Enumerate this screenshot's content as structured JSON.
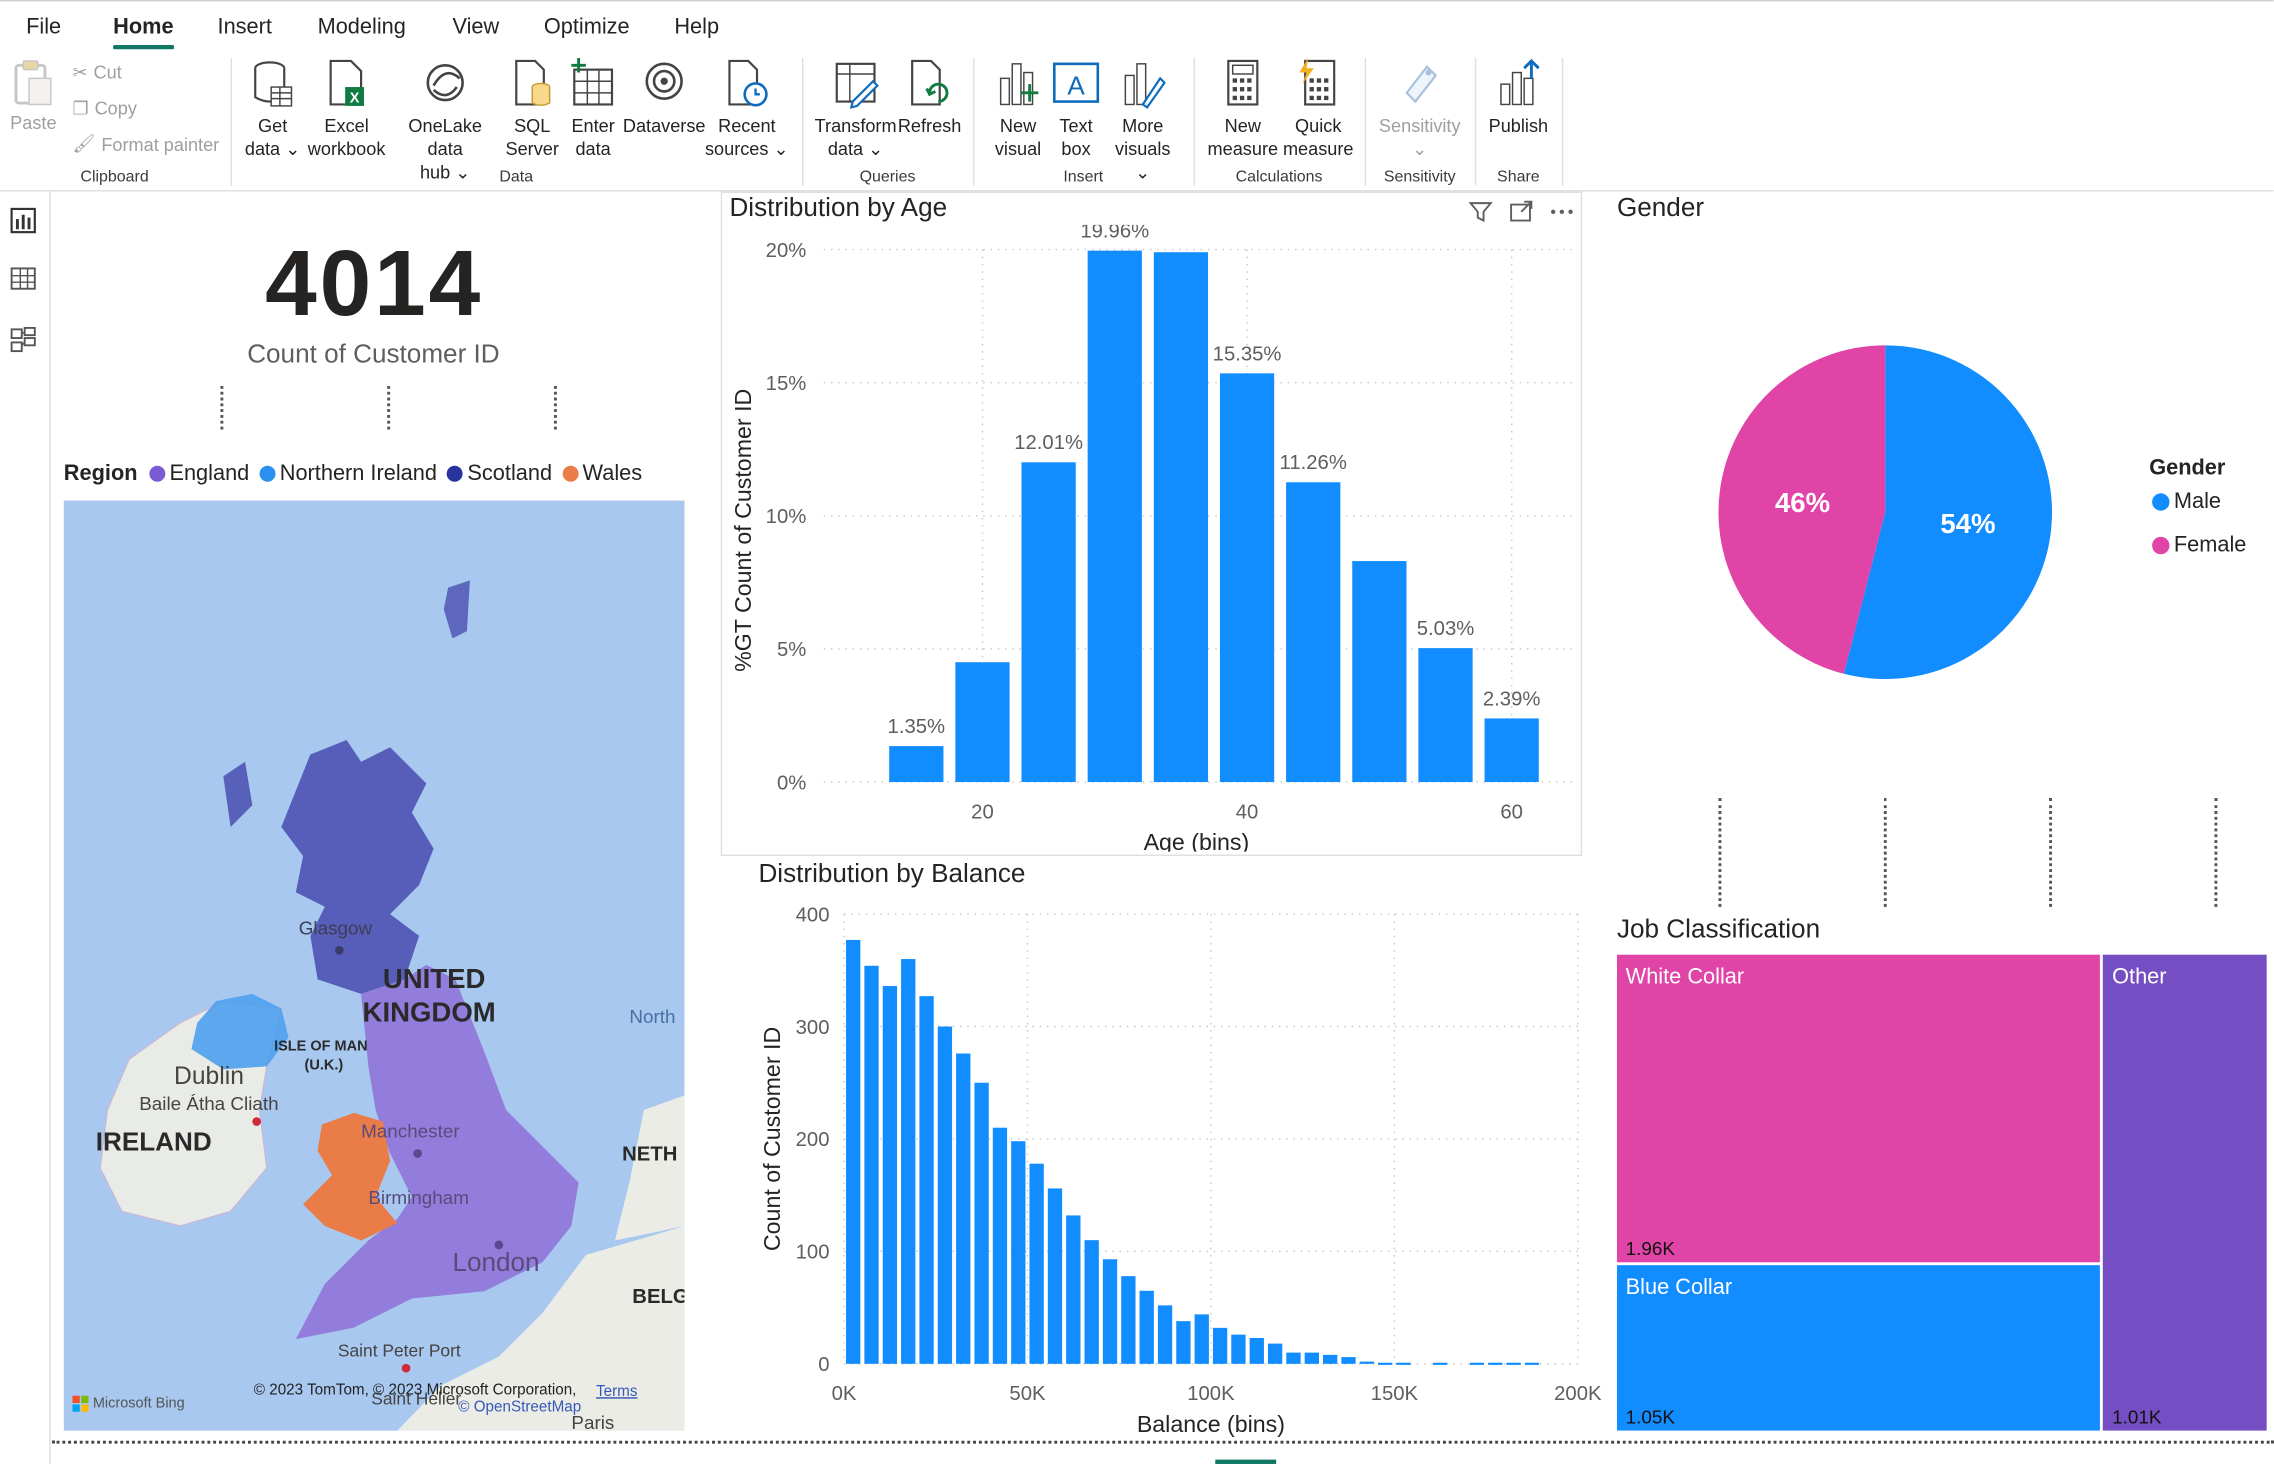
{
  "menu": {
    "tabs": [
      {
        "label": "File"
      },
      {
        "label": "Home"
      },
      {
        "label": "Insert"
      },
      {
        "label": "Modeling"
      },
      {
        "label": "View"
      },
      {
        "label": "Optimize"
      },
      {
        "label": "Help"
      }
    ]
  },
  "ribbon": {
    "clipboard": {
      "paste": "Paste",
      "cut": "Cut",
      "copy": "Copy",
      "format_painter": "Format painter",
      "label": "Clipboard"
    },
    "data": {
      "get_data_1": "Get",
      "get_data_2": "data",
      "excel_1": "Excel",
      "excel_2": "workbook",
      "onelake_1": "OneLake data",
      "onelake_2": "hub",
      "sql_1": "SQL",
      "sql_2": "Server",
      "enter_1": "Enter",
      "enter_2": "data",
      "dataverse": "Dataverse",
      "recent_1": "Recent",
      "recent_2": "sources",
      "label": "Data"
    },
    "queries": {
      "transform_1": "Transform",
      "transform_2": "data",
      "refresh": "Refresh",
      "label": "Queries"
    },
    "insert": {
      "new_visual_1": "New",
      "new_visual_2": "visual",
      "text_box_1": "Text",
      "text_box_2": "box",
      "more_visuals_1": "More",
      "more_visuals_2": "visuals",
      "label": "Insert"
    },
    "calculations": {
      "new_measure_1": "New",
      "new_measure_2": "measure",
      "quick_measure_1": "Quick",
      "quick_measure_2": "measure",
      "label": "Calculations"
    },
    "sensitivity": {
      "btn": "Sensitivity",
      "label": "Sensitivity"
    },
    "share": {
      "publish": "Publish",
      "label": "Share"
    }
  },
  "card": {
    "value": "4014",
    "label": "Count of Customer ID"
  },
  "map": {
    "legend_title": "Region",
    "legend": [
      {
        "name": "England",
        "color": "#7a5bd4"
      },
      {
        "name": "Northern Ireland",
        "color": "#2b8ff0"
      },
      {
        "name": "Scotland",
        "color": "#27349e"
      },
      {
        "name": "Wales",
        "color": "#ea7c48"
      }
    ],
    "labels": {
      "uk_1": "UNITED",
      "uk_2": "KINGDOM",
      "ireland": "IRELAND",
      "dublin": "Dublin",
      "baile": "Baile Átha Cliath",
      "glasgow": "Glasgow",
      "manchester": "Manchester",
      "birmingham": "Birmingham",
      "london": "London",
      "isle_1": "ISLE OF MAN",
      "isle_2": "(U.K.)",
      "north": "North",
      "neth": "NETH",
      "belg": "BELG",
      "saint_peter": "Saint Peter Port",
      "saint_helier": "Saint Helier",
      "paris": "Paris"
    },
    "attribution": "© 2023 TomTom, © 2023 Microsoft Corporation,",
    "terms": "Terms",
    "osm": "© OpenStreetMap",
    "bing": "Microsoft Bing"
  },
  "age_chart": {
    "title": "Distribution by Age",
    "chart_data": {
      "type": "bar",
      "title": "Distribution by Age",
      "xlabel": "Age (bins)",
      "ylabel": "%GT Count of Customer ID",
      "x": [
        15,
        20,
        25,
        30,
        35,
        40,
        45,
        50,
        55,
        60
      ],
      "values": [
        1.35,
        4.5,
        12.01,
        19.96,
        19.9,
        15.35,
        11.26,
        8.3,
        5.03,
        2.39
      ],
      "data_labels": [
        "1.35%",
        "",
        "12.01%",
        "19.96%",
        "",
        "15.35%",
        "11.26%",
        "",
        "5.03%",
        "2.39%"
      ],
      "yticks": [
        "0%",
        "5%",
        "10%",
        "15%",
        "20%"
      ],
      "xticks": [
        "20",
        "40",
        "60"
      ],
      "ylim": [
        0,
        20
      ],
      "color": "#118dff"
    }
  },
  "balance_chart": {
    "title": "Distribution by Balance",
    "chart_data": {
      "type": "bar",
      "title": "Distribution by Balance",
      "xlabel": "Balance (bins)",
      "ylabel": "Count of Customer ID",
      "x": [
        0,
        5000,
        10000,
        15000,
        20000,
        25000,
        30000,
        35000,
        40000,
        45000,
        50000,
        55000,
        60000,
        65000,
        70000,
        75000,
        80000,
        85000,
        90000,
        95000,
        100000,
        105000,
        110000,
        115000,
        120000,
        125000,
        130000,
        135000,
        140000,
        145000,
        150000,
        160000,
        170000,
        175000,
        180000,
        185000
      ],
      "values": [
        377,
        354,
        336,
        360,
        327,
        300,
        276,
        250,
        210,
        198,
        178,
        156,
        132,
        110,
        93,
        78,
        65,
        52,
        38,
        44,
        32,
        26,
        23,
        18,
        10,
        10,
        8,
        6,
        2,
        1,
        1,
        1,
        1,
        1,
        1,
        1
      ],
      "yticks": [
        "0",
        "100",
        "200",
        "300",
        "400"
      ],
      "xticks": [
        "0K",
        "50K",
        "100K",
        "150K",
        "200K"
      ],
      "ylim": [
        0,
        400
      ],
      "xlim": [
        0,
        200000
      ],
      "color": "#118dff"
    }
  },
  "gender_chart": {
    "title": "Gender",
    "legend_title": "Gender",
    "chart_data": {
      "type": "pie",
      "title": "Gender",
      "labels": [
        "Male",
        "Female"
      ],
      "values": [
        54,
        46
      ],
      "value_labels": [
        "54%",
        "46%"
      ],
      "colors": [
        "#118dff",
        "#e044a7"
      ]
    }
  },
  "job_chart": {
    "title": "Job Classification",
    "chart_data": {
      "type": "treemap",
      "labels": [
        "White Collar",
        "Blue Collar",
        "Other"
      ],
      "values": [
        1960,
        1050,
        1010
      ],
      "value_labels": [
        "1.96K",
        "1.05K",
        "1.01K"
      ],
      "colors": [
        "#e044a7",
        "#118dff",
        "#744ec2"
      ]
    }
  }
}
